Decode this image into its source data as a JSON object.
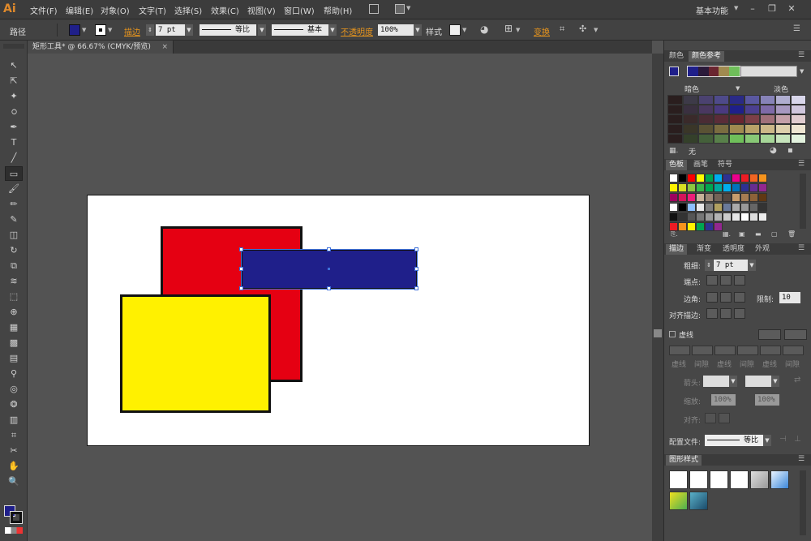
{
  "app": {
    "logo": "Ai"
  },
  "menu": [
    {
      "label": "文件(F)"
    },
    {
      "label": "编辑(E)"
    },
    {
      "label": "对象(O)"
    },
    {
      "label": "文字(T)"
    },
    {
      "label": "选择(S)"
    },
    {
      "label": "效果(C)"
    },
    {
      "label": "视图(V)"
    },
    {
      "label": "窗口(W)"
    },
    {
      "label": "帮助(H)"
    }
  ],
  "workspace": {
    "label": "基本功能"
  },
  "control": {
    "path_label": "路径",
    "fill_color": "#1f1f8a",
    "stroke_label": "描边",
    "stroke_weight": "7 pt",
    "profile1": "等比",
    "profile2": "基本",
    "opacity_label": "不透明度",
    "opacity_value": "100%",
    "style_label": "样式",
    "transform_label": "变换"
  },
  "document": {
    "tab_title": "矩形工具* @ 66.67% (CMYK/预览)",
    "close": "×"
  },
  "shapes": {
    "red": "#e50012",
    "yellow": "#fff100",
    "blue": "#1f1f8a",
    "outline": "#111111",
    "selection": "#3d6fd8"
  },
  "panels": {
    "color_tabs": [
      "颜色",
      "颜色参考"
    ],
    "dark_label": "暗色",
    "light_label": "淡色",
    "none_label": "无",
    "swatch_tabs": [
      "色板",
      "画笔",
      "符号"
    ],
    "stroke_tabs": [
      "描边",
      "渐变",
      "透明度",
      "外观"
    ],
    "weight_label": "粗细:",
    "weight_value": "7 pt",
    "cap_label": "端点:",
    "corner_label": "边角:",
    "limit_label": "限制:",
    "limit_value": "10",
    "align_label": "对齐描边:",
    "dashed_label": "虚线",
    "dash_labels": [
      "虚线",
      "间隙",
      "虚线",
      "间隙",
      "虚线",
      "间隙"
    ],
    "arrow_label": "箭头:",
    "scale_label": "缩放:",
    "scale1": "100%",
    "scale2": "100%",
    "align2_label": "对齐:",
    "profile_label": "配置文件:",
    "profile_value": "等比",
    "graphic_styles_tab": "图形样式"
  }
}
